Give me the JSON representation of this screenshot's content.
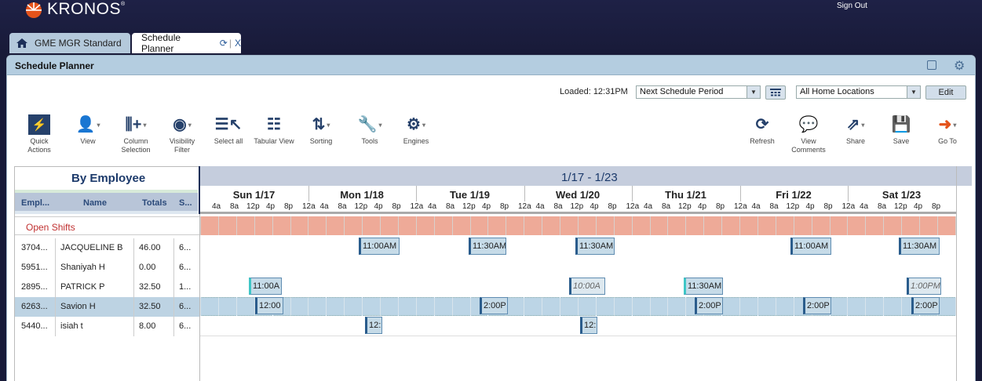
{
  "header": {
    "brand": "KRONOS",
    "sign_out": "Sign Out"
  },
  "tabs": [
    {
      "label": "GME MGR Standard"
    },
    {
      "label": "Schedule Planner",
      "close": "X"
    }
  ],
  "panel": {
    "title": "Schedule Planner"
  },
  "controls": {
    "loaded": "Loaded: 12:31PM",
    "period": "Next Schedule Period",
    "locations": "All Home Locations",
    "edit": "Edit"
  },
  "toolbar": {
    "quick_actions": [
      "Quick",
      "Actions"
    ],
    "view": "View",
    "column_selection": [
      "Column",
      "Selection"
    ],
    "visibility_filter": [
      "Visibility",
      "Filter"
    ],
    "select_all": "Select all",
    "tabular_view": "Tabular View",
    "sorting": "Sorting",
    "tools": "Tools",
    "engines": "Engines",
    "refresh": "Refresh",
    "view_comments": [
      "View",
      "Comments"
    ],
    "share": "Share",
    "save": "Save",
    "go_to": "Go To"
  },
  "left": {
    "header": "By Employee",
    "columns": [
      "Empl...",
      "Name",
      "Totals",
      "S..."
    ],
    "open_shifts": "Open Shifts",
    "rows": [
      {
        "id": "3704...",
        "name": "JACQUELINE B",
        "total": "46.00",
        "s": "6..."
      },
      {
        "id": "5951...",
        "name": "Shaniyah H",
        "total": "0.00",
        "s": "6..."
      },
      {
        "id": "2895...",
        "name": "PATRICK P",
        "total": "32.50",
        "s": "1..."
      },
      {
        "id": "6263...",
        "name": "Savion H",
        "total": "32.50",
        "s": "6..."
      },
      {
        "id": "5440...",
        "name": "isiah t",
        "total": "8.00",
        "s": "6..."
      }
    ]
  },
  "grid": {
    "range": "1/17 - 1/23",
    "days": [
      "Sun 1/17",
      "Mon 1/18",
      "Tue 1/19",
      "Wed 1/20",
      "Thu 1/21",
      "Fri 1/22",
      "Sat 1/23"
    ],
    "hours": [
      "4a",
      "8a",
      "12p",
      "4p",
      "8p",
      "12a"
    ],
    "shifts": {
      "jacqueline": [
        "11:00AM",
        "11:30AM",
        "11:30AM",
        "11:00AM",
        "11:30AM"
      ],
      "patrick": [
        "11:00A",
        "10:00A",
        "11:30AM",
        "1:00PM"
      ],
      "savion": [
        "12:00",
        "2:00P",
        "2:00P",
        "2:00P",
        "2:00P"
      ],
      "isiah": [
        "12:",
        "12:"
      ]
    }
  },
  "colors": {
    "accent": "#26416b",
    "open_shift": "#eeaa98",
    "selected_row": "#bcd5e6"
  }
}
